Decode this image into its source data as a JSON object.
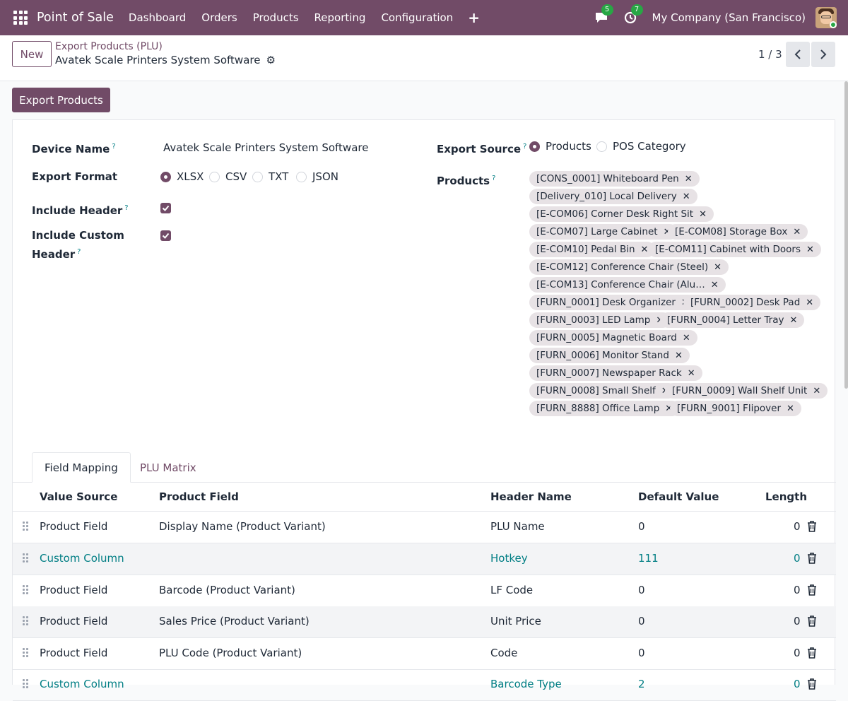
{
  "navbar": {
    "app_name": "Point of Sale",
    "menu": [
      "Dashboard",
      "Orders",
      "Products",
      "Reporting",
      "Configuration"
    ],
    "plus": "+",
    "messages_count": "5",
    "activities_count": "7",
    "company": "My Company (San Francisco)"
  },
  "control": {
    "new_label": "New",
    "breadcrumb_parent": "Export Products (PLU)",
    "record_name": "Avatek Scale Printers System Software",
    "pager": "1 / 3"
  },
  "actions": {
    "export_label": "Export Products"
  },
  "form": {
    "device_name_label": "Device Name",
    "device_name_value": "Avatek Scale Printers System Software",
    "export_format_label": "Export Format",
    "export_formats": [
      "XLSX",
      "CSV",
      "TXT",
      "JSON"
    ],
    "export_format_selected": "XLSX",
    "include_header_label": "Include Header",
    "include_header": true,
    "include_custom_header_label_1": "Include Custom",
    "include_custom_header_label_2": "Header",
    "include_custom_header": true,
    "export_source_label": "Export Source",
    "export_sources": [
      "Products",
      "POS Category"
    ],
    "export_source_selected": "Products",
    "products_label": "Products",
    "help_mark": "?",
    "products": [
      "[CONS_0001] Whiteboard Pen",
      "[Delivery_010] Local Delivery",
      "[E-COM06] Corner Desk Right Sit",
      "[E-COM07] Large Cabinet",
      "[E-COM08] Storage Box",
      "[E-COM10] Pedal Bin",
      "[E-COM11] Cabinet with Doors",
      "[E-COM12] Conference Chair (Steel)",
      "[E-COM13] Conference Chair (Alu…",
      "[FURN_0001] Desk Organizer",
      "[FURN_0002] Desk Pad",
      "[FURN_0003] LED Lamp",
      "[FURN_0004] Letter Tray",
      "[FURN_0005] Magnetic Board",
      "[FURN_0006] Monitor Stand",
      "[FURN_0007] Newspaper Rack",
      "[FURN_0008] Small Shelf",
      "[FURN_0009] Wall Shelf Unit",
      "[FURN_8888] Office Lamp",
      "[FURN_9001] Flipover"
    ],
    "tag_remove": "✕"
  },
  "tabs": [
    "Field Mapping",
    "PLU Matrix"
  ],
  "table": {
    "headers": [
      "Value Source",
      "Product Field",
      "Header Name",
      "Default Value",
      "Length"
    ],
    "rows": [
      {
        "source": "Product Field",
        "field": "Display Name (Product Variant)",
        "header": "PLU Name",
        "default": "0",
        "length": "0"
      },
      {
        "source": "Custom Column",
        "field": "",
        "header": "Hotkey",
        "default": "111",
        "length": "0"
      },
      {
        "source": "Product Field",
        "field": "Barcode (Product Variant)",
        "header": "LF Code",
        "default": "0",
        "length": "0"
      },
      {
        "source": "Product Field",
        "field": "Sales Price (Product Variant)",
        "header": "Unit Price",
        "default": "0",
        "length": "0"
      },
      {
        "source": "Product Field",
        "field": "PLU Code (Product Variant)",
        "header": "Code",
        "default": "0",
        "length": "0"
      },
      {
        "source": "Custom Column",
        "field": "",
        "header": "Barcode Type",
        "default": "2",
        "length": "0"
      }
    ]
  },
  "colors": {
    "brand": "#714b67",
    "link": "#017e84",
    "badge": "#28a745"
  }
}
